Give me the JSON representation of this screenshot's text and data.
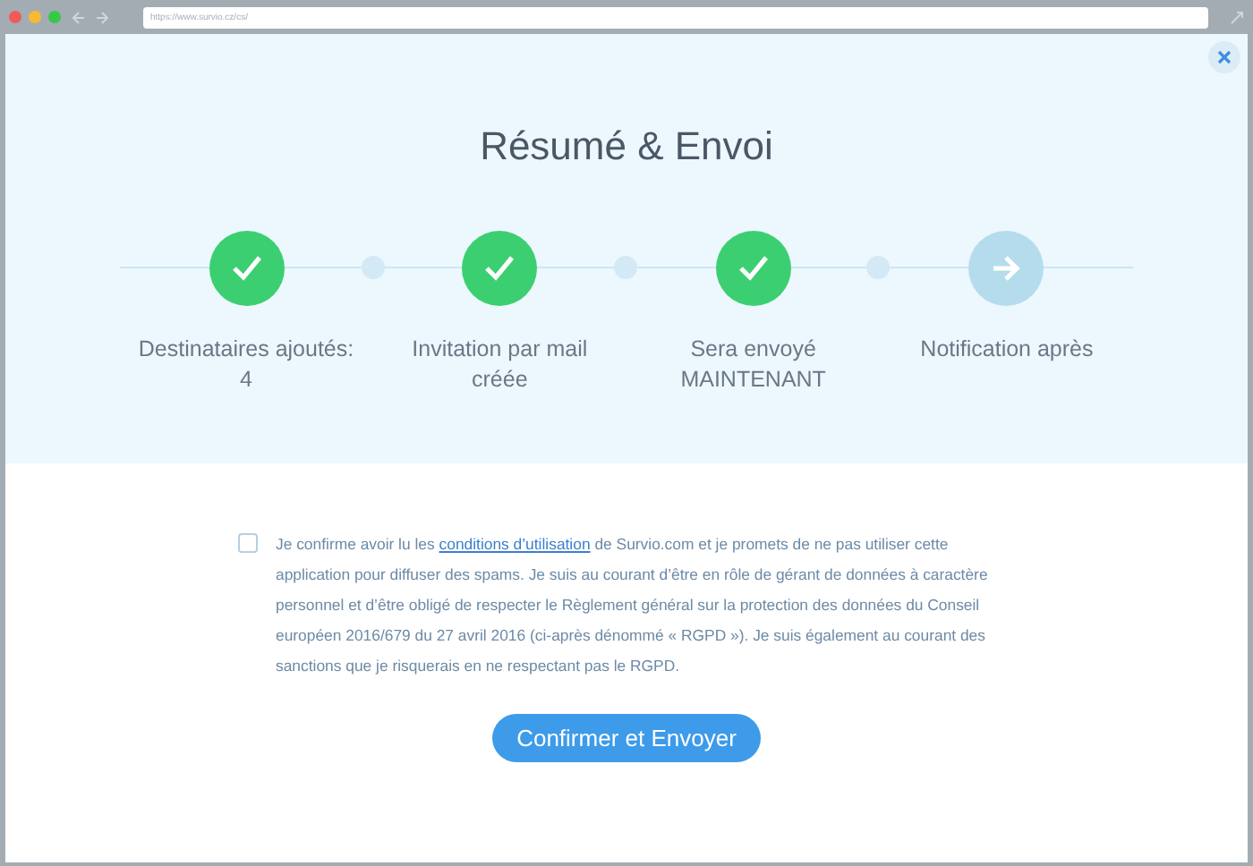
{
  "browser": {
    "url": "https://www.survio.cz/cs/"
  },
  "title": "Résumé & Envoi",
  "steps": [
    {
      "kind": "done",
      "lines": [
        "Destinataires ajoutés:",
        "4"
      ]
    },
    {
      "kind": "done",
      "lines": [
        "Invitation par mail",
        "créée"
      ]
    },
    {
      "kind": "done",
      "lines": [
        "Sera envoyé",
        "MAINTENANT"
      ]
    },
    {
      "kind": "next",
      "lines": [
        "Notification après"
      ]
    }
  ],
  "consent": {
    "checked": false,
    "before": "Je confirme avoir lu les ",
    "link": "conditions d’utilisation",
    "after": " de Survio.com et je promets de ne pas utiliser cette application pour diffuser des spams. Je suis au courant d’être en rôle de gérant de données à caractère personnel et d’être obligé de respecter le Règlement général sur la protection des données du Conseil européen 2016/679 du 27 avril 2016 (ci-après dénommé « RGPD »). Je suis également au courant des sanctions que je risquerais en ne respectant pas le RGPD."
  },
  "button": "Confirmer et Envoyer"
}
